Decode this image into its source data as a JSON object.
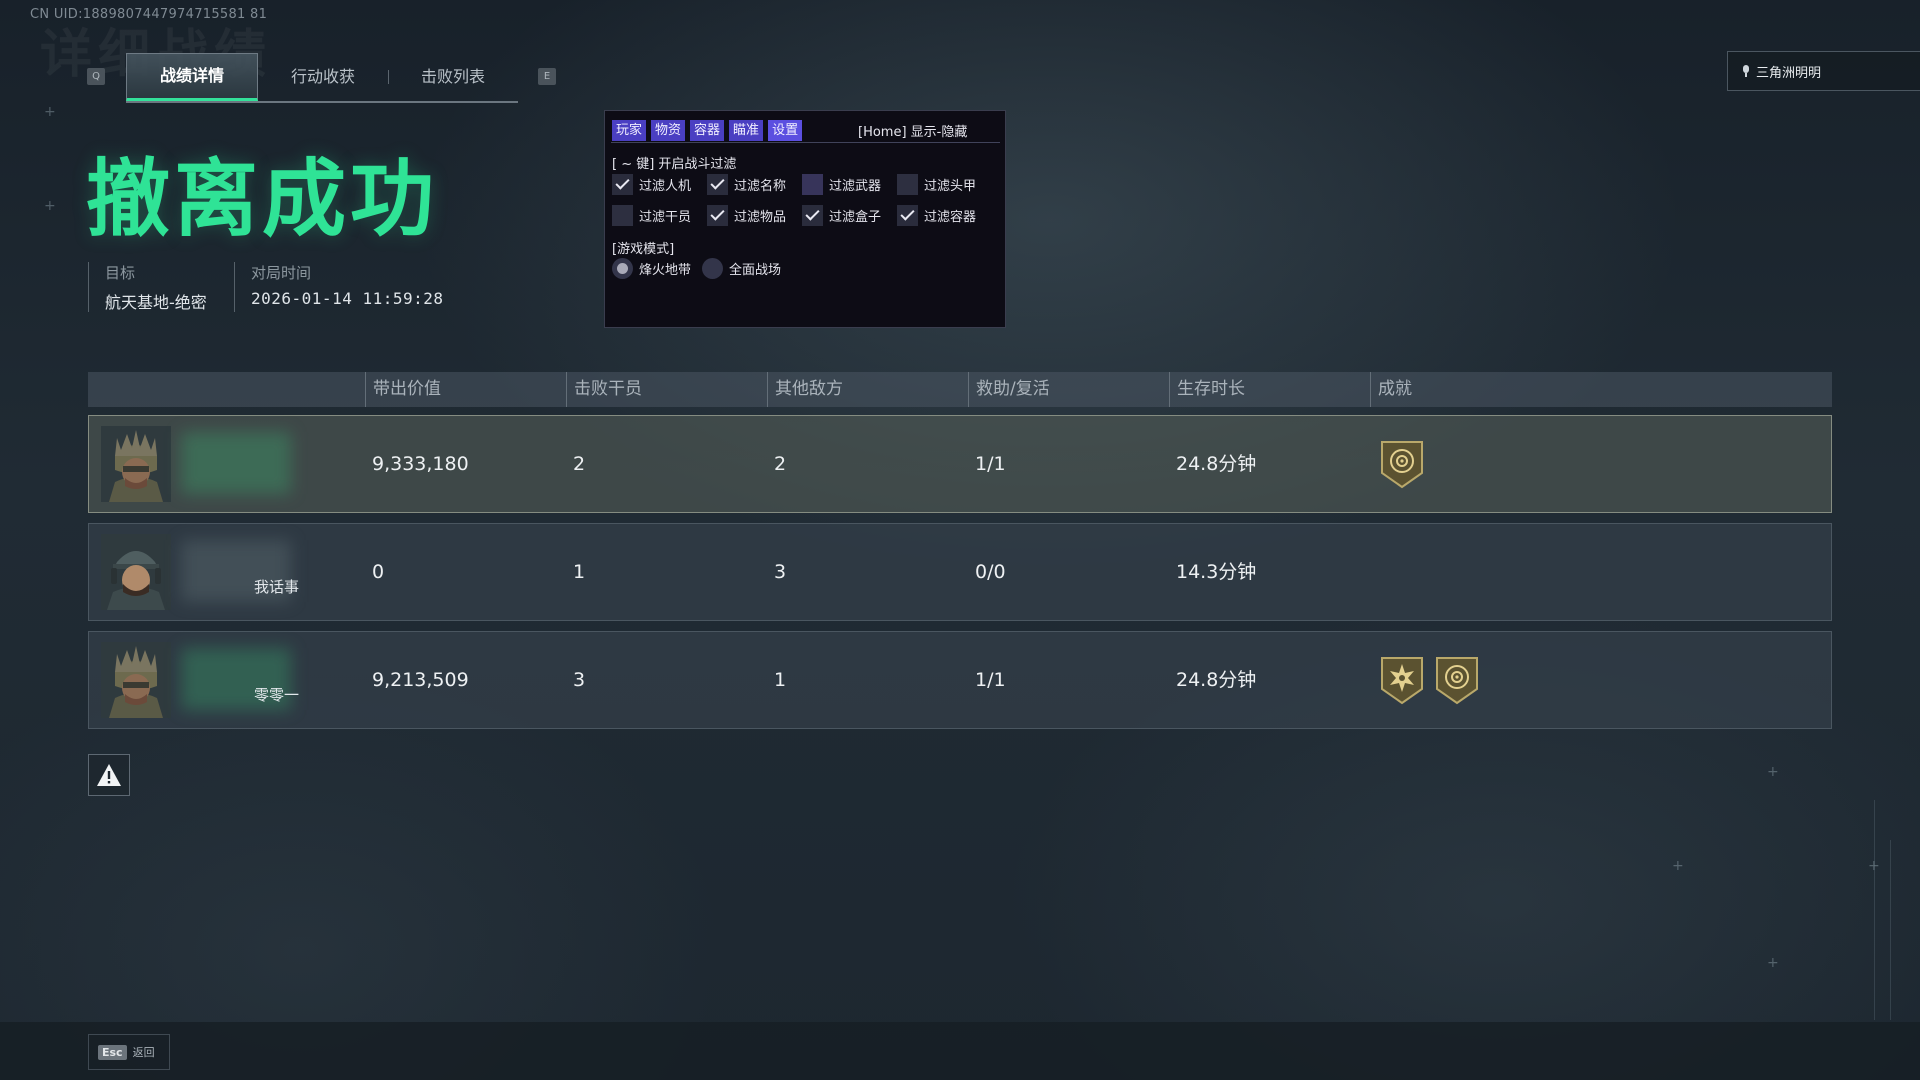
{
  "uid": "CN UID:1889807447974715581 81",
  "watermark": "详细战绩",
  "tabs": {
    "left_key": "Q",
    "right_key": "E",
    "items": [
      {
        "label": "战绩详情",
        "active": true
      },
      {
        "label": "行动收获",
        "active": false
      },
      {
        "label": "击败列表",
        "active": false
      }
    ]
  },
  "account": {
    "name": "三角洲明明",
    "icon": "microphone-icon"
  },
  "result": {
    "title": "撤离成功",
    "color": "#2fe396"
  },
  "meta": {
    "target_label": "目标",
    "target_value": "航天基地-绝密",
    "time_label": "对局时间",
    "time_value": "2026-01-14 11:59:28"
  },
  "overlay": {
    "tabs": [
      "玩家",
      "物资",
      "容器",
      "瞄准",
      "设置"
    ],
    "hint": "[Home] 显示-隐藏",
    "filter_title": "[ ~ 键] 开启战斗过滤",
    "filters": [
      {
        "label": "过滤人机",
        "checked": true
      },
      {
        "label": "过滤名称",
        "checked": true
      },
      {
        "label": "过滤武器",
        "checked": false
      },
      {
        "label": "过滤头甲",
        "checked": false
      },
      {
        "label": "过滤干员",
        "checked": false
      },
      {
        "label": "过滤物品",
        "checked": true
      },
      {
        "label": "过滤盒子",
        "checked": true
      },
      {
        "label": "过滤容器",
        "checked": true
      }
    ],
    "mode_title": "[游戏模式]",
    "modes": [
      {
        "label": "烽火地带",
        "selected": true
      },
      {
        "label": "全面战场",
        "selected": false
      }
    ]
  },
  "table": {
    "headers": [
      "带出价值",
      "击败干员",
      "其他敌方",
      "救助/复活",
      "生存时长",
      "成就"
    ],
    "rows": [
      {
        "name_fragment": "",
        "value": "9,333,180",
        "kills": "2",
        "other": "2",
        "assist": "1/1",
        "survival": "24.8分钟",
        "badges": [
          "target-badge-icon"
        ],
        "highlight": true
      },
      {
        "name_fragment": "我话事",
        "value": "0",
        "kills": "1",
        "other": "3",
        "assist": "0/0",
        "survival": "14.3分钟",
        "badges": [],
        "highlight": false
      },
      {
        "name_fragment": "零零一",
        "value": "9,213,509",
        "kills": "3",
        "other": "1",
        "assist": "1/1",
        "survival": "24.8分钟",
        "badges": [
          "star-badge-icon",
          "target-badge-icon"
        ],
        "highlight": false
      }
    ]
  },
  "report_icon": "warning-icon",
  "footer": {
    "esc_key": "Esc",
    "esc_label": "返回"
  }
}
